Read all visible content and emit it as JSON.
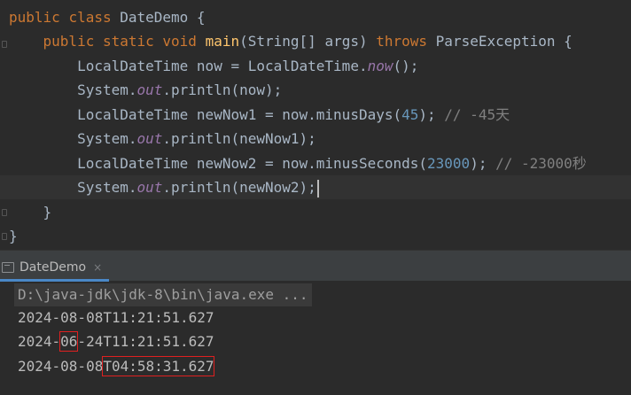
{
  "editor": {
    "lines": [
      [
        {
          "t": "public ",
          "c": "kw"
        },
        {
          "t": "class ",
          "c": "kw"
        },
        {
          "t": "DateDemo {",
          "c": "pl"
        }
      ],
      [
        {
          "t": "    "
        },
        {
          "t": "public ",
          "c": "kw"
        },
        {
          "t": "static ",
          "c": "kw"
        },
        {
          "t": "void ",
          "c": "kw"
        },
        {
          "t": "main",
          "c": "fn"
        },
        {
          "t": "(String[] args) ",
          "c": "pl"
        },
        {
          "t": "throws ",
          "c": "kw"
        },
        {
          "t": "ParseException {",
          "c": "pl"
        }
      ],
      [
        {
          "t": "        LocalDateTime now = LocalDateTime.",
          "c": "pl"
        },
        {
          "t": "now",
          "c": "st"
        },
        {
          "t": "();",
          "c": "pl"
        }
      ],
      [
        {
          "t": "        System.",
          "c": "pl"
        },
        {
          "t": "out",
          "c": "st"
        },
        {
          "t": ".println(now);",
          "c": "pl"
        }
      ],
      [
        {
          "t": "        LocalDateTime newNow1 = now.minusDays(",
          "c": "pl"
        },
        {
          "t": "45",
          "c": "num"
        },
        {
          "t": "); ",
          "c": "pl"
        },
        {
          "t": "// -45天",
          "c": "cm"
        }
      ],
      [
        {
          "t": "        System.",
          "c": "pl"
        },
        {
          "t": "out",
          "c": "st"
        },
        {
          "t": ".println(newNow1);",
          "c": "pl"
        }
      ],
      [
        {
          "t": "        LocalDateTime newNow2 = now.minusSeconds(",
          "c": "pl"
        },
        {
          "t": "23000",
          "c": "num"
        },
        {
          "t": "); ",
          "c": "pl"
        },
        {
          "t": "// -23000秒",
          "c": "cm"
        }
      ],
      [
        {
          "t": "        System.",
          "c": "pl"
        },
        {
          "t": "out",
          "c": "st"
        },
        {
          "t": ".println(newNow2);",
          "c": "pl"
        }
      ],
      [
        {
          "t": "    }",
          "c": "pl"
        }
      ],
      [
        {
          "t": "}",
          "c": "pl"
        }
      ]
    ],
    "current_line": 7
  },
  "run_panel": {
    "tab_label": "DateDemo",
    "tab_icon": "console-icon",
    "close_icon": "×",
    "command": "D:\\java-jdk\\jdk-8\\bin\\java.exe ...",
    "output": [
      "2024-08-08T11:21:51.627",
      "2024-06-24T11:21:51.627",
      "2024-08-08T04:58:31.627"
    ]
  }
}
